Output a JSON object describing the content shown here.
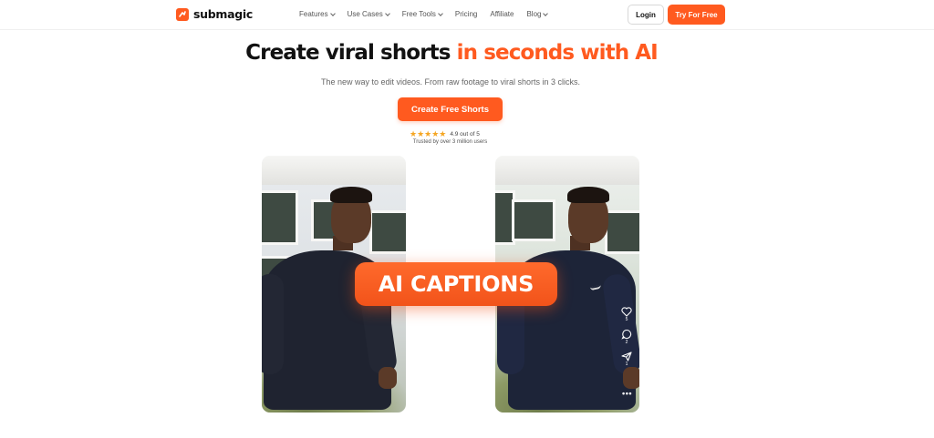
{
  "brand": {
    "name": "submagic",
    "accent": "#ff5a1f"
  },
  "nav": {
    "items": [
      {
        "label": "Features",
        "has_dropdown": true
      },
      {
        "label": "Use Cases",
        "has_dropdown": true
      },
      {
        "label": "Free Tools",
        "has_dropdown": true
      },
      {
        "label": "Pricing",
        "has_dropdown": false
      },
      {
        "label": "Affiliate",
        "has_dropdown": false
      },
      {
        "label": "Blog",
        "has_dropdown": true
      }
    ],
    "login_label": "Login",
    "try_label": "Try For Free"
  },
  "hero": {
    "headline_main": "Create viral shorts ",
    "headline_accent": "in seconds with AI",
    "subheadline": "The new way to edit videos. From raw footage to viral shorts in 3 clicks.",
    "cta_label": "Create Free Shorts",
    "rating_stars": "★★★★★",
    "rating_text": "4.9 out of 5",
    "trusted_text": "Trusted by over 3 million users"
  },
  "demo": {
    "caption_text": "AI CAPTIONS",
    "right_card_icons": [
      {
        "icon": "heart-icon",
        "count": "5"
      },
      {
        "icon": "comment-icon",
        "count": "2"
      },
      {
        "icon": "share-icon",
        "count": "1"
      }
    ],
    "more_icon": "•••"
  }
}
